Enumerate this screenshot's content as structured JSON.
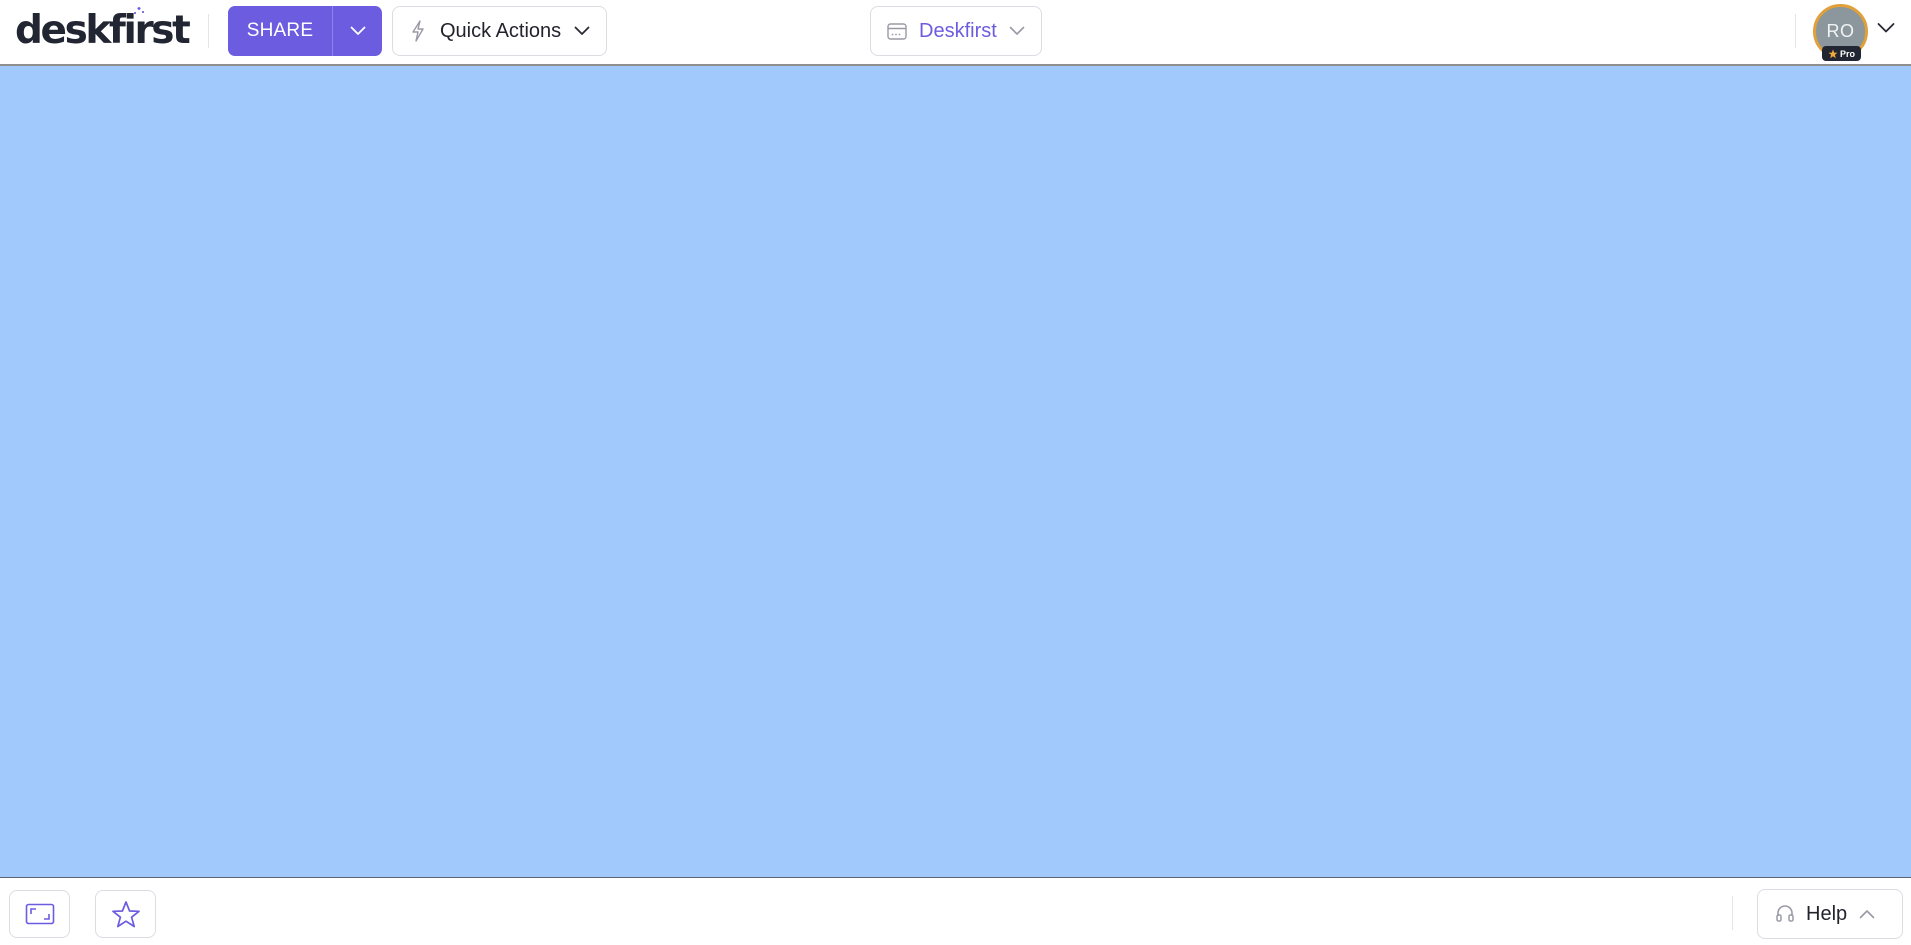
{
  "header": {
    "logo_text": "deskfirst",
    "share": {
      "label": "SHARE"
    },
    "quick_actions": {
      "label": "Quick Actions"
    },
    "workspace": {
      "label": "Deskfirst"
    },
    "account": {
      "initials": "RO",
      "badge": "Pro"
    }
  },
  "canvas": {
    "background": "#a1c9fc"
  },
  "footer": {
    "help": {
      "label": "Help"
    }
  },
  "icons": {
    "share_menu": "chevron-down-icon",
    "quick_actions": "lightning-bolt-icon",
    "workspace": "window-icon",
    "fit": "fit-to-screen-icon",
    "favorite": "star-icon",
    "help": "headset-icon"
  },
  "colors": {
    "accent": "#6c5ce0",
    "avatar_ring": "#e1a03a",
    "canvas": "#a1c9fc"
  }
}
